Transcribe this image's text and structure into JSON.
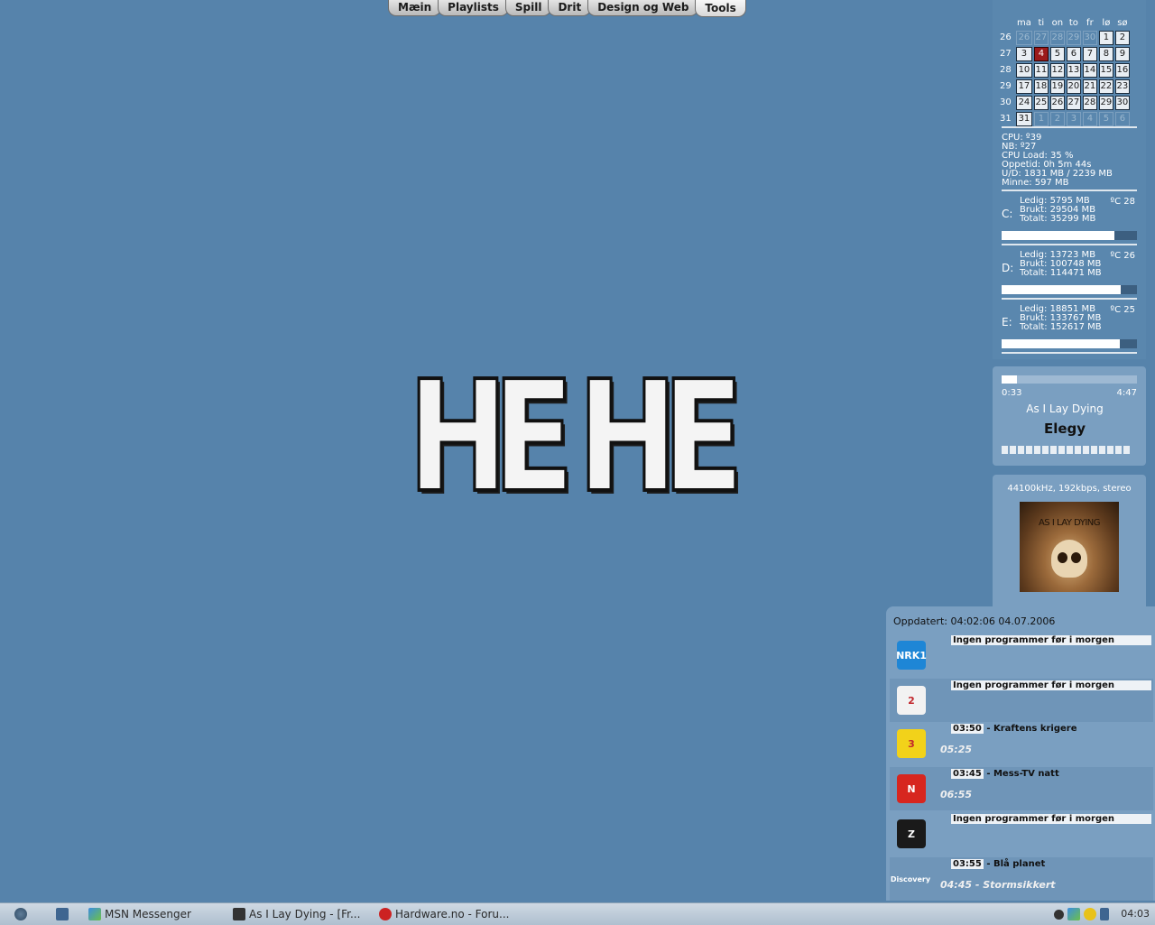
{
  "tabs": [
    "Mæin",
    "Playlists",
    "Spill",
    "Drit",
    "Design og Web",
    "Tools"
  ],
  "wallpaper_text": [
    "H",
    "E",
    "H",
    "E"
  ],
  "calendar": {
    "headers": [
      "ma",
      "ti",
      "on",
      "to",
      "fr",
      "lø",
      "sø"
    ],
    "weeks": [
      {
        "wk": "26",
        "days": [
          "26",
          "27",
          "28",
          "29",
          "30",
          "1",
          "2"
        ],
        "dim": [
          0,
          1,
          2,
          3,
          4
        ]
      },
      {
        "wk": "27",
        "days": [
          "3",
          "4",
          "5",
          "6",
          "7",
          "8",
          "9"
        ],
        "today": 1
      },
      {
        "wk": "28",
        "days": [
          "10",
          "11",
          "12",
          "13",
          "14",
          "15",
          "16"
        ]
      },
      {
        "wk": "29",
        "days": [
          "17",
          "18",
          "19",
          "20",
          "21",
          "22",
          "23"
        ]
      },
      {
        "wk": "30",
        "days": [
          "24",
          "25",
          "26",
          "27",
          "28",
          "29",
          "30"
        ]
      },
      {
        "wk": "31",
        "days": [
          "31",
          "1",
          "2",
          "3",
          "4",
          "5",
          "6"
        ],
        "dim": [
          1,
          2,
          3,
          4,
          5,
          6
        ]
      }
    ]
  },
  "system": {
    "cpu": "CPU: º39",
    "nb": "NB: º27",
    "load": "CPU Load: 35 %",
    "uptime": "Oppetid: 0h 5m 44s",
    "ud": "U/D: 1831 MB  /  2239 MB",
    "mem": "Minne: 597 MB"
  },
  "drives": [
    {
      "letter": "C:",
      "free": "Ledig: 5795 MB",
      "used": "Brukt: 29504 MB",
      "total": "Totalt: 35299 MB",
      "temp": "ºC 28",
      "used_fraction": 0.83
    },
    {
      "letter": "D:",
      "free": "Ledig: 13723 MB",
      "used": "Brukt: 100748 MB",
      "total": "Totalt: 114471 MB",
      "temp": "ºC 26",
      "used_fraction": 0.88
    },
    {
      "letter": "E:",
      "free": "Ledig: 18851 MB",
      "used": "Brukt: 133767 MB",
      "total": "Totalt: 152617 MB",
      "temp": "ºC 25",
      "used_fraction": 0.87
    }
  ],
  "player": {
    "elapsed": "0:33",
    "duration": "4:47",
    "artist": "As I Lay Dying",
    "title": "Elegy",
    "progress_fraction": 0.11
  },
  "album": {
    "format": "44100kHz, 192kbps, stereo",
    "cover_text": "AS I LAY DYING"
  },
  "tvguide": {
    "updated": "Oppdatert: 04:02:06 04.07.2006",
    "channels": [
      {
        "logo": "NRK1",
        "logo_color": "#1e86d6",
        "now_time": "",
        "now": "Ingen programmer før i morgen",
        "next": ""
      },
      {
        "logo": "2",
        "logo_color": "#f2f2f2",
        "now_time": "",
        "now": "Ingen programmer før i morgen",
        "next": ""
      },
      {
        "logo": "3",
        "logo_color": "#f2d21a",
        "now_time": "03:50",
        "now": " - Kraftens krigere",
        "next": "05:25"
      },
      {
        "logo": "N",
        "logo_color": "#d7261f",
        "now_time": "03:45",
        "now": " - Mess-TV natt",
        "next": "06:55"
      },
      {
        "logo": "Z",
        "logo_color": "#1a1a1a",
        "now_time": "",
        "now": "Ingen programmer før i morgen",
        "next": ""
      },
      {
        "logo": "Discovery",
        "logo_color": "#6f95b8",
        "now_time": "03:55",
        "now": " - Blå planet",
        "next": "04:45 - Stormsikkert"
      }
    ]
  },
  "taskbar": {
    "items": [
      "MSN Messenger",
      "As I Lay Dying - [Fr...",
      "Hardware.no - Foru..."
    ],
    "clock": "04:03"
  }
}
